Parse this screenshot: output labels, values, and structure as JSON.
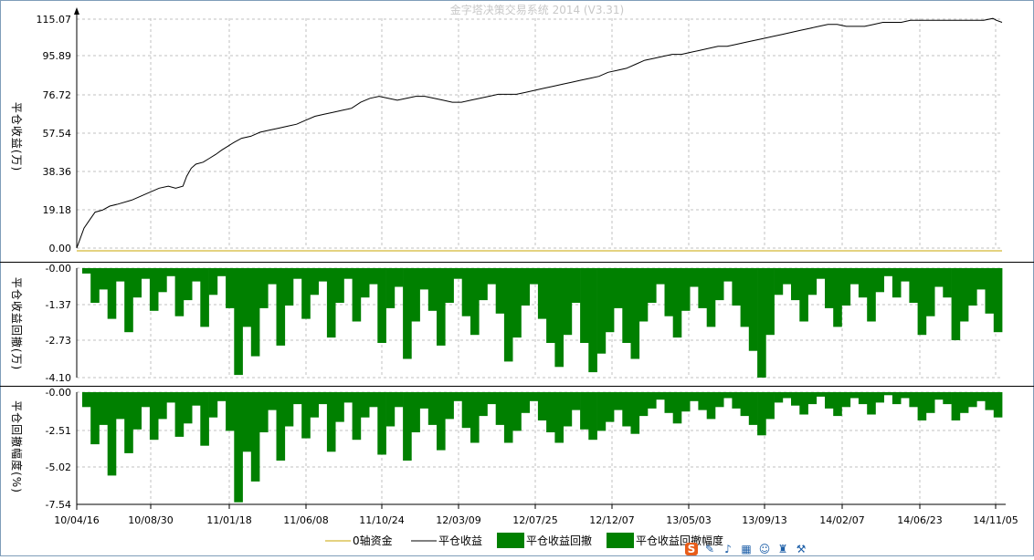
{
  "title": "金字塔决策交易系统 2014 (V3.31)",
  "colors": {
    "profit_line": "#000000",
    "zero_line": "#c8a400",
    "drawdown_fill": "#008000",
    "grid": "#c0c0c0",
    "title": "#c8c8c8"
  },
  "chart_data": [
    {
      "type": "line",
      "name": "profit-panel",
      "ylabel": "平仓收益(万)",
      "yticks": [
        "115.07",
        "95.89",
        "76.72",
        "57.54",
        "38.36",
        "19.18",
        "0.00"
      ],
      "ylim": [
        0,
        115.07
      ],
      "grid": true,
      "x": [
        0,
        4,
        8,
        14,
        20,
        28,
        36,
        45,
        60,
        70,
        80,
        90,
        100,
        108,
        116,
        120,
        125,
        130,
        138,
        145,
        152,
        158,
        165,
        172,
        180,
        190,
        200,
        210,
        220,
        230,
        240,
        250,
        260,
        270,
        280,
        290,
        300,
        310,
        320,
        330,
        340,
        350,
        360,
        370,
        380,
        390,
        400,
        410,
        420,
        430,
        440,
        450,
        460,
        470,
        480,
        490,
        500,
        510,
        520,
        530,
        540,
        550,
        560,
        570,
        580,
        590,
        600,
        610,
        620,
        630,
        640,
        650,
        660,
        670,
        680,
        690,
        700,
        710,
        720,
        730,
        740,
        750,
        760,
        770,
        780,
        790,
        800,
        810,
        820,
        830,
        840,
        850,
        860,
        870,
        880,
        890,
        900,
        910,
        920,
        930,
        940,
        950,
        960,
        970,
        980,
        990,
        1000,
        1004,
        1010
      ],
      "series": [
        {
          "name": "平仓收益",
          "values": [
            0,
            5,
            10,
            14,
            18,
            19,
            21,
            22,
            24,
            26,
            28,
            30,
            31,
            30,
            31,
            36,
            40,
            42,
            43,
            45,
            47,
            49,
            51,
            53,
            55,
            56,
            58,
            59,
            60,
            61,
            62,
            64,
            66,
            67,
            68,
            69,
            70,
            73,
            75,
            76,
            75,
            74,
            75,
            76,
            76,
            75,
            74,
            73,
            73,
            74,
            75,
            76,
            77,
            77,
            77,
            78,
            79,
            80,
            81,
            82,
            83,
            84,
            85,
            86,
            88,
            89,
            90,
            92,
            94,
            95,
            96,
            97,
            97,
            98,
            99,
            100,
            101,
            101,
            102,
            103,
            104,
            105,
            106,
            107,
            108,
            109,
            110,
            111,
            112,
            112,
            111,
            111,
            111,
            112,
            113,
            113,
            113,
            114,
            114,
            114,
            114,
            114,
            114,
            114,
            114,
            114,
            115,
            114,
            113
          ]
        },
        {
          "name": "0轴资金",
          "values": [
            0,
            0
          ]
        }
      ]
    },
    {
      "type": "area",
      "name": "drawdown-panel",
      "ylabel": "平仓收益回撤(万)",
      "yticks": [
        "-0.00",
        "-1.37",
        "-2.73",
        "-4.10"
      ],
      "ylim": [
        -4.1,
        0
      ],
      "grid": true,
      "series": [
        {
          "name": "平仓收益回撤",
          "values": [
            -0.2,
            -1.3,
            -0.8,
            -1.9,
            -0.5,
            -2.4,
            -1.1,
            -0.4,
            -1.6,
            -0.9,
            -0.3,
            -1.8,
            -1.2,
            -0.5,
            -2.2,
            -1.0,
            -0.3,
            -1.5,
            -4.0,
            -2.2,
            -3.3,
            -1.5,
            -0.6,
            -2.9,
            -1.4,
            -0.4,
            -1.9,
            -1.0,
            -0.5,
            -2.6,
            -1.3,
            -0.4,
            -2.0,
            -1.1,
            -0.6,
            -2.8,
            -1.5,
            -0.7,
            -3.4,
            -2.0,
            -0.8,
            -1.6,
            -2.9,
            -1.3,
            -0.4,
            -1.8,
            -2.5,
            -1.2,
            -0.6,
            -1.7,
            -3.5,
            -2.6,
            -1.4,
            -0.6,
            -1.9,
            -2.8,
            -3.7,
            -2.5,
            -1.3,
            -2.8,
            -3.9,
            -3.2,
            -2.4,
            -1.5,
            -2.8,
            -3.4,
            -2.0,
            -1.3,
            -0.6,
            -1.8,
            -2.6,
            -1.6,
            -0.7,
            -1.5,
            -2.2,
            -1.2,
            -0.5,
            -1.4,
            -2.2,
            -3.1,
            -4.1,
            -2.5,
            -1.0,
            -0.6,
            -1.2,
            -2.0,
            -1.0,
            -0.4,
            -1.5,
            -2.2,
            -1.4,
            -0.6,
            -1.1,
            -2.0,
            -0.9,
            -0.3,
            -1.1,
            -0.5,
            -1.3,
            -2.5,
            -1.8,
            -0.7,
            -1.1,
            -2.7,
            -2.0,
            -1.4,
            -0.8,
            -1.7,
            -2.4
          ]
        }
      ]
    },
    {
      "type": "area",
      "name": "drawdown-pct-panel",
      "ylabel": "平仓回撤幅度(%)",
      "yticks": [
        "-0.00",
        "-2.51",
        "-5.02",
        "-7.54"
      ],
      "ylim": [
        -7.54,
        0
      ],
      "grid": true,
      "series": [
        {
          "name": "平仓收益回撤幅度",
          "values": [
            -1.0,
            -3.5,
            -2.2,
            -5.6,
            -1.8,
            -4.1,
            -2.5,
            -1.0,
            -3.2,
            -1.8,
            -0.7,
            -3.0,
            -2.1,
            -0.9,
            -3.6,
            -1.7,
            -0.6,
            -2.6,
            -7.4,
            -4.0,
            -6.0,
            -2.7,
            -1.2,
            -4.6,
            -2.3,
            -0.8,
            -3.1,
            -1.7,
            -0.8,
            -4.0,
            -2.0,
            -0.7,
            -3.2,
            -1.7,
            -1.0,
            -4.2,
            -2.3,
            -1.0,
            -4.6,
            -2.7,
            -1.1,
            -2.2,
            -3.9,
            -1.8,
            -0.6,
            -2.4,
            -3.4,
            -1.6,
            -0.8,
            -2.2,
            -3.4,
            -2.6,
            -1.4,
            -0.6,
            -1.9,
            -2.7,
            -3.4,
            -2.3,
            -1.2,
            -2.5,
            -3.2,
            -2.6,
            -2.0,
            -1.2,
            -2.3,
            -2.8,
            -1.6,
            -1.1,
            -0.5,
            -1.4,
            -2.1,
            -1.3,
            -0.6,
            -1.2,
            -1.8,
            -1.0,
            -0.4,
            -1.1,
            -1.6,
            -2.2,
            -2.9,
            -1.8,
            -0.7,
            -0.4,
            -0.9,
            -1.5,
            -0.8,
            -0.3,
            -1.1,
            -1.6,
            -1.0,
            -0.4,
            -0.8,
            -1.5,
            -0.7,
            -0.2,
            -0.8,
            -0.4,
            -1.0,
            -1.9,
            -1.4,
            -0.5,
            -0.8,
            -1.9,
            -1.4,
            -1.0,
            -0.6,
            -1.2,
            -1.7
          ]
        }
      ]
    }
  ],
  "x_axis": {
    "ticks": [
      "10/04/16",
      "10/08/30",
      "11/01/18",
      "11/06/08",
      "11/10/24",
      "12/03/09",
      "12/07/25",
      "12/12/07",
      "13/05/03",
      "13/09/13",
      "14/02/07",
      "14/06/23",
      "14/11/05"
    ]
  },
  "legend": [
    {
      "label": "0轴资金",
      "kind": "line",
      "color": "#c8a400"
    },
    {
      "label": "平仓收益",
      "kind": "line",
      "color": "#000000"
    },
    {
      "label": "平仓收益回撤",
      "kind": "box",
      "color": "#008000"
    },
    {
      "label": "平仓收益回撤幅度",
      "kind": "box",
      "color": "#008000"
    }
  ],
  "toolbar_icons": [
    "sogou-s-icon",
    "pen-icon",
    "mic-icon",
    "keyboard-icon",
    "user-icon",
    "shirt-icon",
    "wrench-icon"
  ]
}
